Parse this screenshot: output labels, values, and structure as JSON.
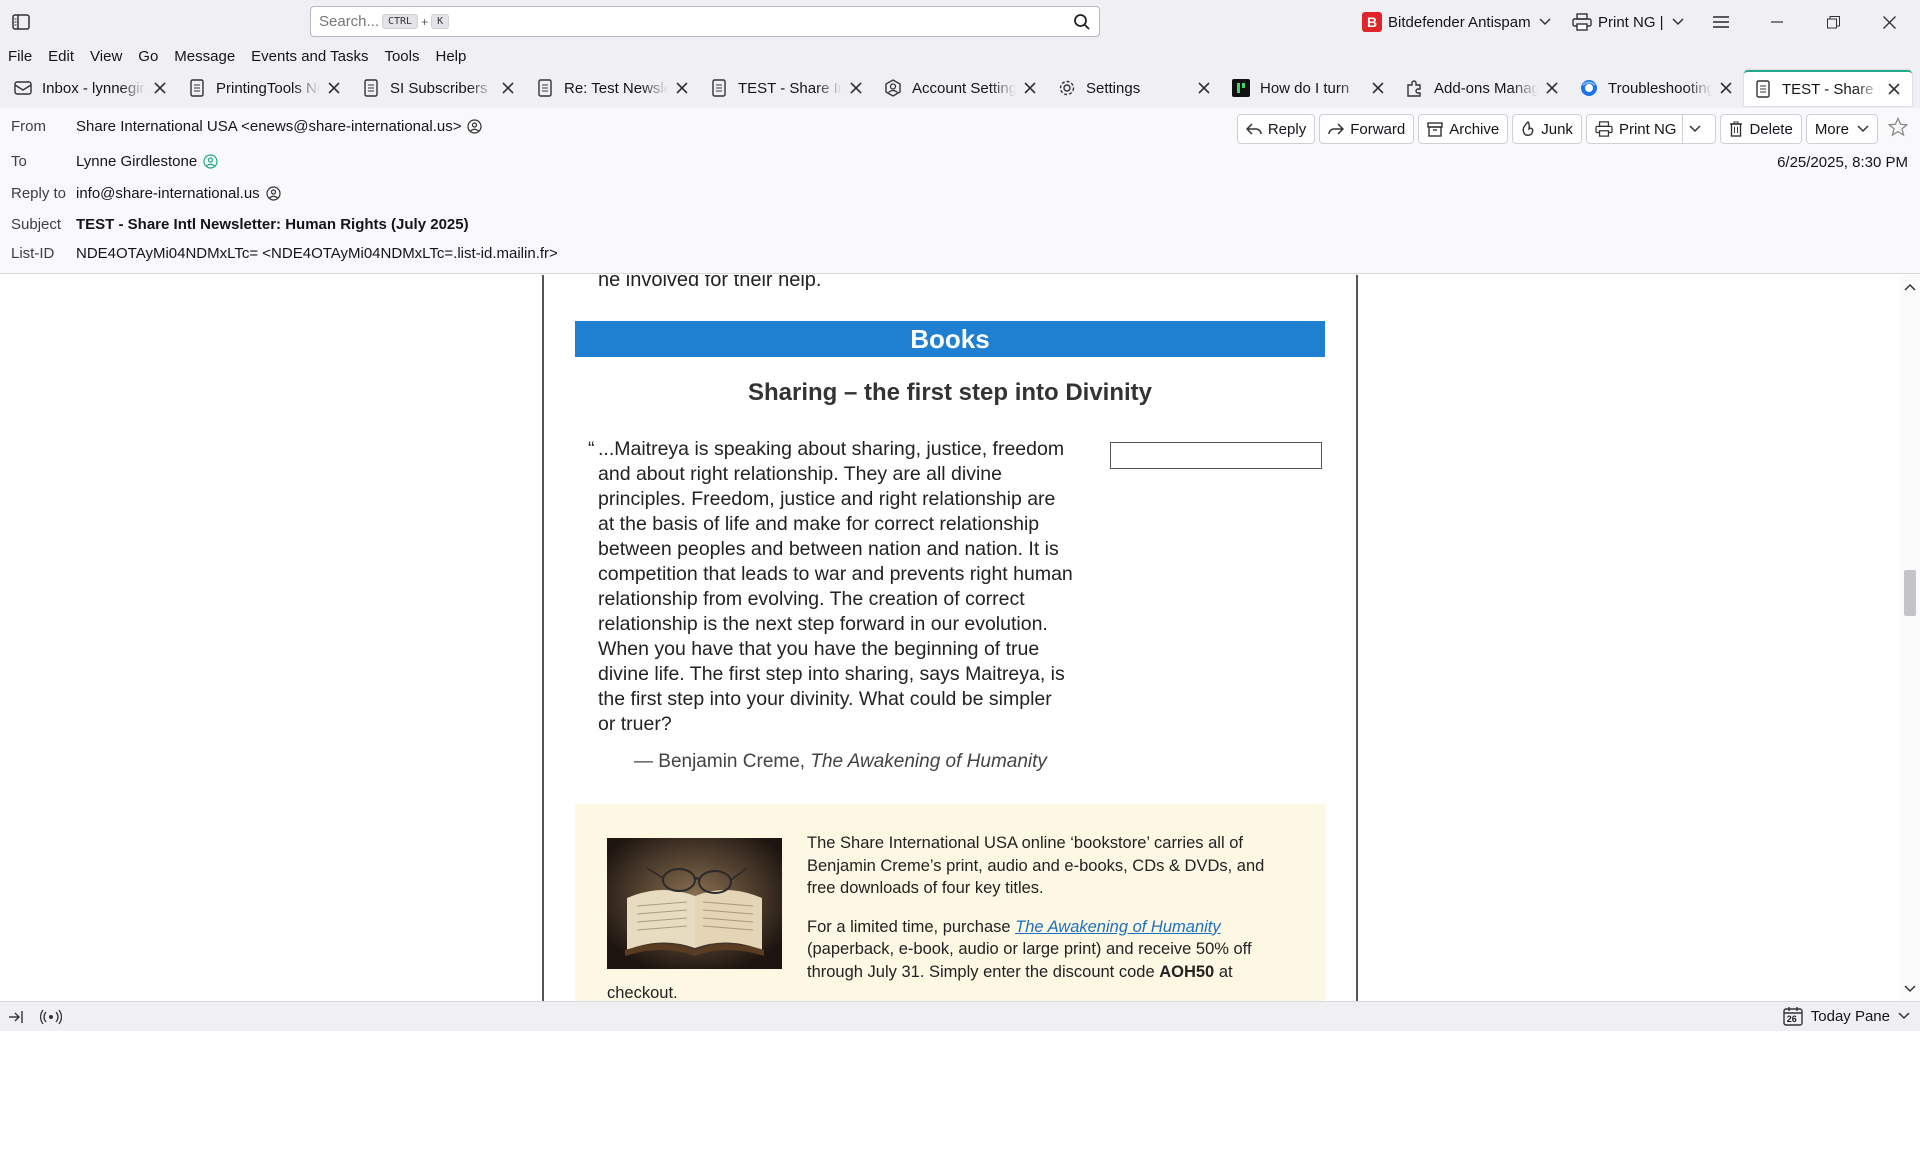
{
  "search": {
    "placeholder": "Search...",
    "key1": "CTRL",
    "plus": "+",
    "key2": "K"
  },
  "toolbar": {
    "addon_antispam": "Bitdefender Antispam",
    "addon_antispam_logo": "B",
    "addon_print": "Print NG |"
  },
  "menu": [
    "File",
    "Edit",
    "View",
    "Go",
    "Message",
    "Events and Tasks",
    "Tools",
    "Help"
  ],
  "tabs": [
    {
      "label": "Inbox - lynnegirdlestone",
      "icon": "mail-icon"
    },
    {
      "label": "PrintingTools NG",
      "icon": "document-icon"
    },
    {
      "label": "SI Subscribers",
      "icon": "document-icon"
    },
    {
      "label": "Re: Test Newsletter",
      "icon": "document-icon"
    },
    {
      "label": "TEST - Share Intl",
      "icon": "document-icon"
    },
    {
      "label": "Account Settings",
      "icon": "account-icon"
    },
    {
      "label": "Settings",
      "icon": "gear-icon"
    },
    {
      "label": "How do I turn",
      "icon": "app-icon"
    },
    {
      "label": "Add-ons Manager",
      "icon": "puzzle-icon"
    },
    {
      "label": "Troubleshooting",
      "icon": "thunderbird-icon"
    },
    {
      "label": "TEST - Share Intl",
      "icon": "document-icon",
      "active": true
    }
  ],
  "header": {
    "from_label": "From",
    "from_value": "Share International USA <enews@share-international.us>",
    "to_label": "To",
    "to_value": "Lynne Girdlestone",
    "replyto_label": "Reply to",
    "replyto_value": "info@share-international.us",
    "subject_label": "Subject",
    "subject_value": "TEST - Share Intl Newsletter: Human Rights (July 2025)",
    "listid_label": "List-ID",
    "listid_value": "NDE4OTAyMi04NDMxLTc= <NDE4OTAyMi04NDMxLTc=.list-id.mailin.fr>",
    "date": "6/25/2025, 8:30 PM",
    "actions": {
      "reply": "Reply",
      "forward": "Forward",
      "archive": "Archive",
      "junk": "Junk",
      "print": "Print NG",
      "delete": "Delete",
      "more": "More"
    }
  },
  "body": {
    "carry_text": "he involved for their help.",
    "books_banner": "Books",
    "article_title": "Sharing – the first step into Divinity",
    "quote_mark": "“",
    "quote_text": "...Maitreya is speaking about sharing, justice, freedom and about right relationship. They are all divine principles. Freedom, justice and right relationship are at the basis of life and make for correct relationship between peoples and between nation and nation. It is competition that leads to war and prevents right human relationship from evolving. The creation of correct relationship is the next step forward in our evolution. When you have that you have the beginning of true divine life. The first step into sharing, says Maitreya, is the first step into your divinity. What could be simpler or truer?",
    "attribution_prefix": "— Benjamin Creme, ",
    "attribution_title": "The Awakening of Humanity",
    "promo_p1": "The Share International USA online ‘bookstore’ carries all of Benjamin Creme’s print, audio and e-books, CDs & DVDs, and free downloads of four key titles.",
    "promo_p2_before": "For a limited time, purchase ",
    "promo_p2_link": "The Awakening of Humanity",
    "promo_p2_after": " (paperback, e-book, audio or large print) and receive 50% off through July 31. Simply enter the discount code ",
    "promo_code": "AOH50",
    "promo_p2_end": " at",
    "promo_tail": "checkout."
  },
  "status": {
    "today_pane": "Today Pane",
    "calendar_day": "26"
  },
  "colors": {
    "accent": "#23a88b",
    "banner": "#1f7fd1",
    "promo_bg": "#fdf8e4",
    "link": "#1f6fbf"
  }
}
